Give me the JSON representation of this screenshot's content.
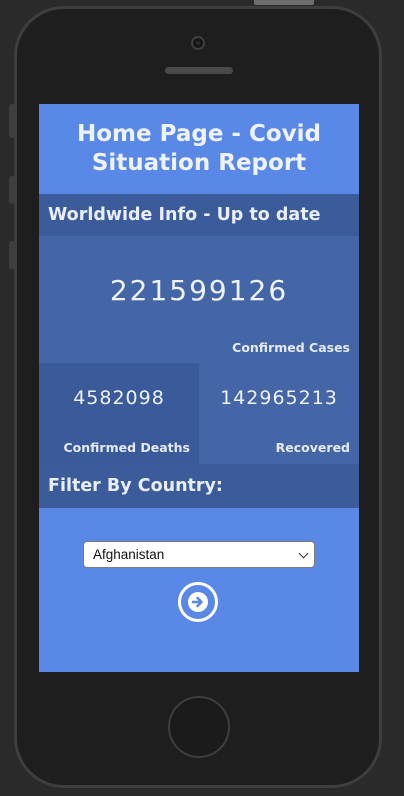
{
  "page": {
    "title": "Home Page - Covid Situation Report"
  },
  "worldwide": {
    "heading": "Worldwide Info - Up to date",
    "confirmed_cases": {
      "value": "221599126",
      "label": "Confirmed Cases"
    },
    "confirmed_deaths": {
      "value": "4582098",
      "label": "Confirmed Deaths"
    },
    "recovered": {
      "value": "142965213",
      "label": "Recovered"
    }
  },
  "filter": {
    "heading": "Filter By Country:",
    "selected_country": "Afghanistan",
    "submit_icon": "arrow-right-circle-icon"
  },
  "colors": {
    "screen_background": "#5a88e6",
    "section_bar": "#3b5b9b",
    "panel_light": "#4566a6",
    "panel_dark": "#3a5a9a"
  }
}
